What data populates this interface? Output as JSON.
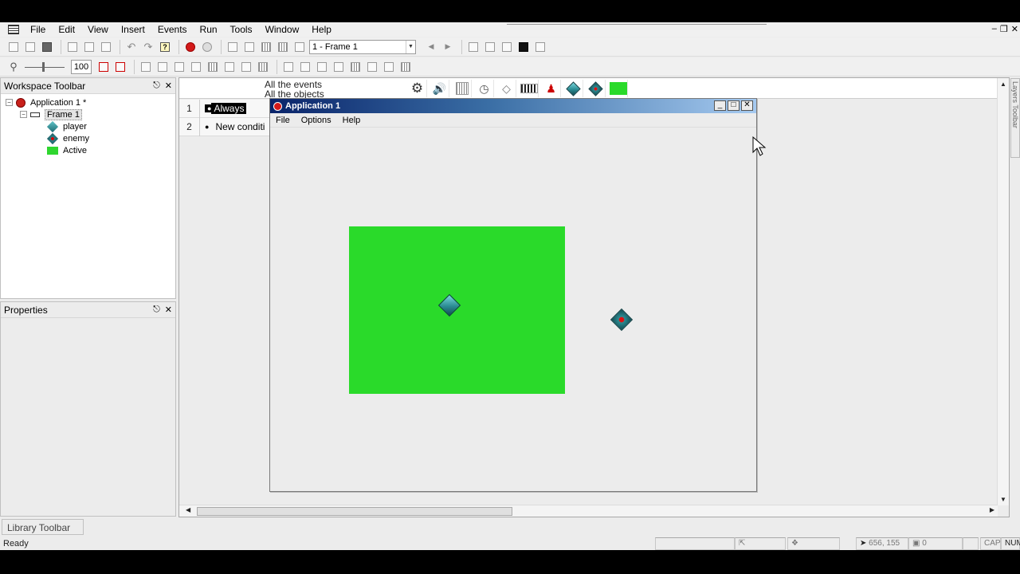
{
  "menubar": {
    "items": [
      "File",
      "Edit",
      "View",
      "Insert",
      "Events",
      "Run",
      "Tools",
      "Window",
      "Help"
    ]
  },
  "toolbar": {
    "frame_select": "1 - Frame 1",
    "zoom_value": "100"
  },
  "workspace": {
    "title": "Workspace Toolbar",
    "tree": {
      "application": "Application 1 *",
      "frame": "Frame 1",
      "objects": [
        "player",
        "enemy",
        "Active"
      ]
    }
  },
  "properties": {
    "title": "Properties"
  },
  "library": {
    "tab_label": "Library Toolbar"
  },
  "status": {
    "text": "Ready",
    "coords": "656, 155",
    "count": "0",
    "caps": "CAP",
    "num": "NUM"
  },
  "event_editor": {
    "header_line1": "All the events",
    "header_line2": "All the objects",
    "rows": [
      {
        "num": "1",
        "condition": "Always"
      },
      {
        "num": "2",
        "condition": "New conditi"
      }
    ]
  },
  "layers_tab": "Layers Toolbar",
  "run_window": {
    "title": "Application 1",
    "menu": [
      "File",
      "Options",
      "Help"
    ]
  },
  "colors": {
    "active_green": "#2ada2a",
    "titlebar_start": "#0a246a",
    "titlebar_end": "#a6caf0"
  }
}
